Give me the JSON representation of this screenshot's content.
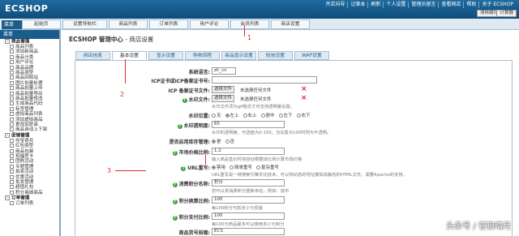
{
  "app": {
    "logo": "ECSHOP"
  },
  "top_links": [
    "开店向导",
    "记事本",
    "刷新",
    "个人设置",
    "管理员留言",
    "查看网店",
    "帮助",
    "关于 ECSHOP"
  ],
  "top_buttons": {
    "calc": "清除缓存",
    "search": "计算器"
  },
  "menu_label": "菜单",
  "nav_tabs": [
    "起始页",
    "设置导航栏",
    "商品列表",
    "订单列表",
    "用户评论",
    "会员列表",
    "商店设置"
  ],
  "sidebar": {
    "header": "菜单",
    "items": [
      {
        "text": "商品管理",
        "type": "grp"
      },
      {
        "text": "商品列表",
        "type": "sub"
      },
      {
        "text": "添加新商品",
        "type": "sub"
      },
      {
        "text": "商品分类",
        "type": "sub"
      },
      {
        "text": "用户评论",
        "type": "sub"
      },
      {
        "text": "商品品牌",
        "type": "sub"
      },
      {
        "text": "商品类型",
        "type": "sub"
      },
      {
        "text": "商品回收站",
        "type": "sub"
      },
      {
        "text": "图片批量处理",
        "type": "sub"
      },
      {
        "text": "商品批量上传",
        "type": "sub"
      },
      {
        "text": "商品批量导出",
        "type": "sub"
      },
      {
        "text": "商品批量修改",
        "type": "sub"
      },
      {
        "text": "生成商品代码",
        "type": "sub"
      },
      {
        "text": "标签管理",
        "type": "sub"
      },
      {
        "text": "虚拟商品列表",
        "type": "sub"
      },
      {
        "text": "添加虚拟商品",
        "type": "sub"
      },
      {
        "text": "更改加密串",
        "type": "sub"
      },
      {
        "text": "商品自动上下架",
        "type": "sub"
      },
      {
        "text": "促销管理",
        "type": "grp"
      },
      {
        "text": "夺宝奇兵",
        "type": "sub"
      },
      {
        "text": "红包类型",
        "type": "sub"
      },
      {
        "text": "商品包装",
        "type": "sub"
      },
      {
        "text": "祝福贺卡",
        "type": "sub"
      },
      {
        "text": "团购活动",
        "type": "sub"
      },
      {
        "text": "专题管理",
        "type": "sub"
      },
      {
        "text": "拍卖活动",
        "type": "sub"
      },
      {
        "text": "优惠活动",
        "type": "sub"
      },
      {
        "text": "批发管理",
        "type": "sub"
      },
      {
        "text": "超值礼包",
        "type": "sub"
      },
      {
        "text": "积分商城商品",
        "type": "sub"
      },
      {
        "text": "订单管理",
        "type": "grp"
      },
      {
        "text": "订单列表",
        "type": "sub"
      }
    ]
  },
  "page_head": {
    "brand": "ECSHOP 管理中心",
    "sep": " - ",
    "title": "商店设置"
  },
  "sub_tabs": [
    "网店信息",
    "基本设置",
    "显示设置",
    "购物流程",
    "商品显示设置",
    "短信设置",
    "WAP设置"
  ],
  "active_sub_tab": 1,
  "form": {
    "lang_label": "系统语言:",
    "lang_value": "zh_cn",
    "icp_label": "ICP证书或ICP备案证书号:",
    "icp_file_label": "ICP 备案证书文件:",
    "file_btn": "选择文件",
    "file_none": "未选择任何文件",
    "watermark_label": "水印文件:",
    "watermark_hint": "水印文件须为gif格式才可支持透明度设置。",
    "wm_pos_label": "水印位置:",
    "wm_pos_options": [
      "无",
      "左上",
      "右上",
      "居中",
      "左下",
      "右下"
    ],
    "wm_alpha_label": "水印透明度:",
    "wm_alpha_value": "65",
    "wm_alpha_hint": "水印的透明度，可选值为0-100。当设置为100时则为不透明。",
    "rewrite_label": "是否启用库存管理:",
    "stock_options": [
      "是",
      "否"
    ],
    "market_price_label": "市场价格比例:",
    "market_price_value": "1.2",
    "market_price_hint": "输入商品售价时将自动根据该比例计算市场价格",
    "url_label": "URL重写:",
    "url_options": [
      "禁用",
      "简单重写",
      "复杂重写"
    ],
    "url_hint": "URL重写是一种搜索引擎优化技术，可以将动态的地址模拟成静态的HTML文件。需要Apache的支持。",
    "points_name_label": "消费积分名称:",
    "points_name_value": "积分",
    "points_name_hint": "您可以将消费积分重新命名。例如：烧币",
    "points_rate_label": "积分换算比例:",
    "points_rate_value": "100",
    "points_rate_hint": "每100积分可抵多少元现金",
    "points_pay_label": "积分支付比例:",
    "points_pay_value": "100",
    "points_pay_hint": "每100元商品最多可以使用多少元积分",
    "sn_prefix_label": "商品货号前缀:",
    "sn_prefix_value": "ECS"
  },
  "annotations": [
    "1",
    "2",
    "3"
  ],
  "watermark": "头条号 / 苍狼晴月"
}
